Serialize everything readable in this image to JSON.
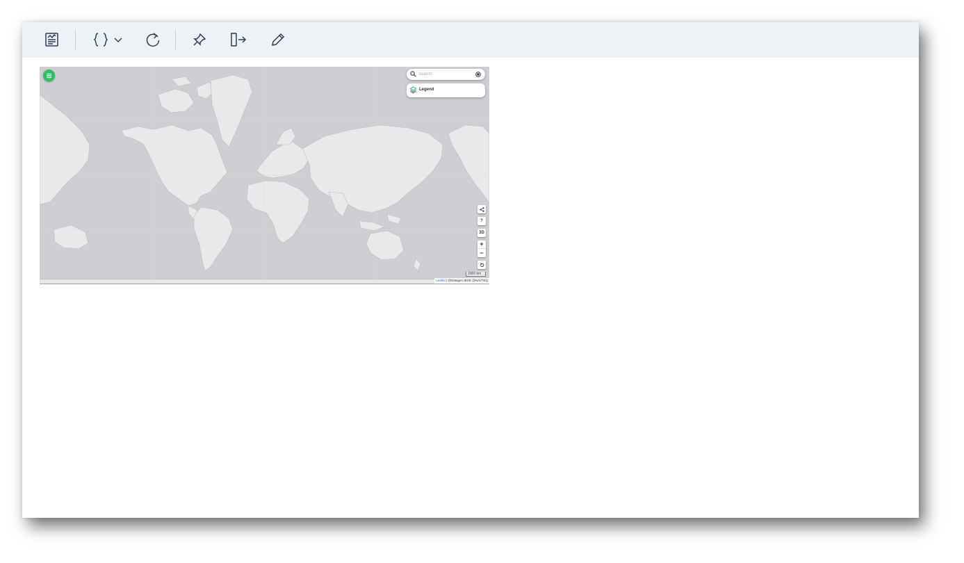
{
  "toolbar": {
    "buttons": [
      {
        "name": "report",
        "icon": "report-icon"
      },
      {
        "name": "variables",
        "icon": "curly-braces-icon",
        "dropdown_icon": "chevron-down-icon"
      },
      {
        "name": "refresh",
        "icon": "refresh-icon"
      },
      {
        "name": "pin",
        "icon": "pin-icon"
      },
      {
        "name": "exit",
        "icon": "exit-icon"
      },
      {
        "name": "edit",
        "icon": "pencil-icon"
      }
    ]
  },
  "map": {
    "menu_icon": "hamburger-menu-icon",
    "menu_color": "#2dbf63",
    "search": {
      "placeholder": "Search",
      "icon": "search-icon",
      "locate_icon": "locate-icon"
    },
    "legend": {
      "label": "Legend",
      "icon": "layers-icon"
    },
    "controls": {
      "share_icon": "share-icon",
      "help_label": "?",
      "view_3d_label": "3D",
      "zoom_in_label": "+",
      "zoom_out_label": "−",
      "reset_icon": "reset-icon"
    },
    "scale_label": "2000 km",
    "attribution": {
      "link": "Leaflet",
      "separator": " | ",
      "text": "@Datageo IBGE @NAVTEQ"
    },
    "colors": {
      "ocean": "#cfcfd3",
      "land": "#e9e9ea",
      "border": "#bdbdc1"
    }
  }
}
